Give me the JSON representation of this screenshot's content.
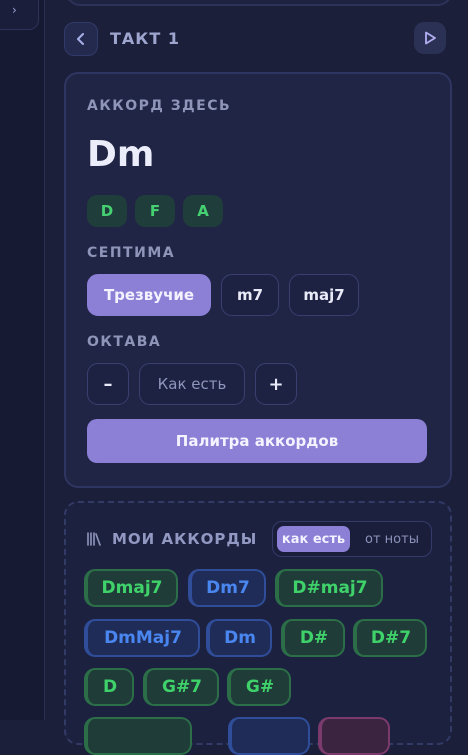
{
  "header": {
    "tact_label": "ТАКТ 1"
  },
  "chord_card": {
    "section_label": "АККОРД ЗДЕСЬ",
    "chord_name": "Dm",
    "notes": [
      "D",
      "F",
      "A"
    ],
    "seventh_label": "СЕПТИМА",
    "seventh_options": [
      "Трезвучие",
      "m7",
      "maj7"
    ],
    "seventh_selected": "Трезвучие",
    "octave_label": "ОКТАВА",
    "octave_minus": "–",
    "octave_value": "Как есть",
    "octave_plus": "+",
    "palette_button": "Палитра аккордов"
  },
  "my_chords": {
    "title": "МОИ АККОРДЫ",
    "toggle": {
      "on": "как есть",
      "off": "от ноты"
    },
    "chips": [
      {
        "label": "Dmaj7",
        "color": "green"
      },
      {
        "label": "Dm7",
        "color": "blue"
      },
      {
        "label": "D#maj7",
        "color": "green"
      },
      {
        "label": "DmMaj7",
        "color": "blue"
      },
      {
        "label": "Dm",
        "color": "blue"
      },
      {
        "label": "D#",
        "color": "green"
      },
      {
        "label": "D#7",
        "color": "green"
      },
      {
        "label": "D",
        "color": "green"
      },
      {
        "label": "G#7",
        "color": "green"
      },
      {
        "label": "G#",
        "color": "green"
      },
      {
        "label": "",
        "color": "green"
      },
      {
        "label": "",
        "color": "blue"
      },
      {
        "label": "",
        "color": "pink"
      }
    ]
  },
  "colors": {
    "accent": "#8b7fd6",
    "background": "#1b1f3a",
    "note_green": "#45d172",
    "chip_blue": "#4a86f0"
  },
  "icons": {
    "prev": "chevron-left-icon",
    "next": "play-icon",
    "library": "library-icon",
    "sidebar": "chevron-icon"
  }
}
